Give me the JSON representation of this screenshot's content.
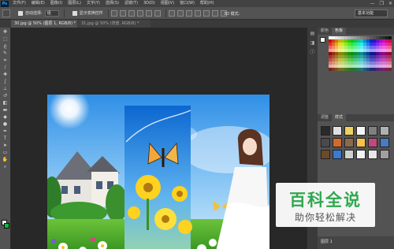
{
  "app": {
    "logo": "Ps",
    "menus": [
      "文件(F)",
      "编辑(E)",
      "图像(I)",
      "图层(L)",
      "文字(Y)",
      "选择(S)",
      "滤镜(T)",
      "3D(D)",
      "视图(V)",
      "窗口(W)",
      "帮助(H)"
    ],
    "window_controls": [
      "—",
      "❐",
      "✕"
    ]
  },
  "options": {
    "auto_select_label": "自动选择:",
    "auto_select_value": "组",
    "show_transform_label": "显示变换控件",
    "mode_3d_label": "3D 模式:",
    "workspace": "基本功能"
  },
  "tabs": [
    {
      "label": "30.jpg @ 50% (图层 1, RGB/8) *",
      "active": true
    },
    {
      "label": "31.jpg @ 50% (背景, RGB/8) *",
      "active": false
    }
  ],
  "panels": {
    "swatches_tabs": [
      "颜色",
      "色板"
    ],
    "styles_tabs": [
      "调整",
      "样式"
    ],
    "layer_row": "图层 1"
  },
  "colors": {
    "background_swatch": "#10b53c",
    "foreground_swatch": "#ffffff"
  },
  "watermark": {
    "title": "百科全说",
    "subtitle": "助你轻松解决"
  }
}
